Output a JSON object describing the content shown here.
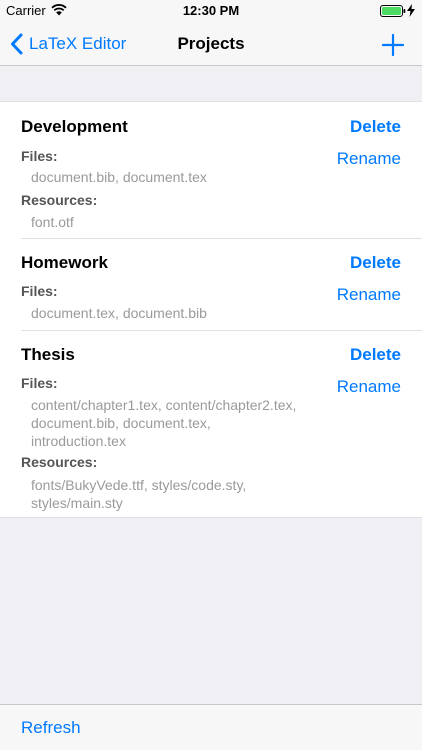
{
  "status_bar": {
    "carrier": "Carrier",
    "time": "12:30 PM"
  },
  "nav": {
    "back_label": "LaTeX Editor",
    "title": "Projects",
    "add_icon": "plus-icon"
  },
  "projects": [
    {
      "name": "Development",
      "delete_label": "Delete",
      "rename_label": "Rename",
      "files_label": "Files:",
      "files": "document.bib, document.tex",
      "resources_label": "Resources:",
      "resources": "font.otf"
    },
    {
      "name": "Homework",
      "delete_label": "Delete",
      "rename_label": "Rename",
      "files_label": "Files:",
      "files": "document.tex, document.bib"
    },
    {
      "name": "Thesis",
      "delete_label": "Delete",
      "rename_label": "Rename",
      "files_label": "Files:",
      "files_lines": [
        "content/chapter1.tex, content/chapter2.tex,",
        "document.bib, document.tex,",
        "introduction.tex"
      ],
      "resources_label": "Resources:",
      "resources_lines": [
        "fonts/BukyVede.ttf, styles/code.sty,",
        "styles/main.sty"
      ]
    }
  ],
  "toolbar": {
    "refresh_label": "Refresh"
  },
  "colors": {
    "accent": "#007aff",
    "background": "#efeff4",
    "secondary_text": "#9a9a9a"
  }
}
